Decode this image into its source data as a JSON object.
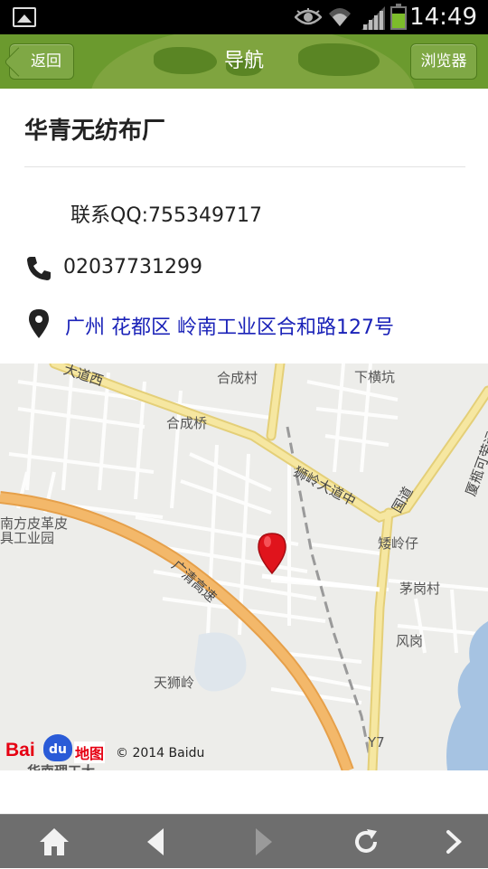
{
  "status_bar": {
    "time": "14:49",
    "battery_level": 0.75,
    "icons": [
      "gallery-icon",
      "eye-icon",
      "wifi-icon",
      "signal-icon",
      "battery-icon"
    ]
  },
  "header": {
    "title": "导航",
    "back_label": "返回",
    "browser_label": "浏览器"
  },
  "place": {
    "name": "华青无纺布厂",
    "qq": "联系QQ:755349717",
    "phone": "02037731299",
    "address": "广州 花都区 岭南工业区合和路127号"
  },
  "map": {
    "labels": {
      "hecheng_village": "合成村",
      "hecheng_bridge": "合成桥",
      "xiahengkeng": "下横坑",
      "dadao_west": "大道西",
      "shiling_dadao_mid": "狮岭大道中",
      "yonglingzai": "矮岭仔",
      "maogang_village": "茅岗村",
      "fenggang": "风岗",
      "tianshiling": "天狮岭",
      "guangqing_highway": "广清高速",
      "leather_park_1": "南方皮革皮",
      "leather_park_2": "具工业园",
      "south_road": "厦瓶可劳运",
      "east_road": "国道",
      "road_code": "Y7",
      "bottom_cut": "华南理工大"
    },
    "logo_text": [
      "Bai",
      "du",
      "地图"
    ],
    "copyright": "© 2014 Baidu",
    "colors": {
      "background": "#ededea",
      "main_road": "#f6e7a1",
      "highway": "#f3b86a",
      "water": "#a6c3e2",
      "marker": "#e0141c"
    }
  },
  "nav_bar": {
    "buttons": [
      "home-icon",
      "back-arrow-icon",
      "forward-arrow-icon",
      "refresh-icon",
      "more-arrow-icon"
    ]
  }
}
